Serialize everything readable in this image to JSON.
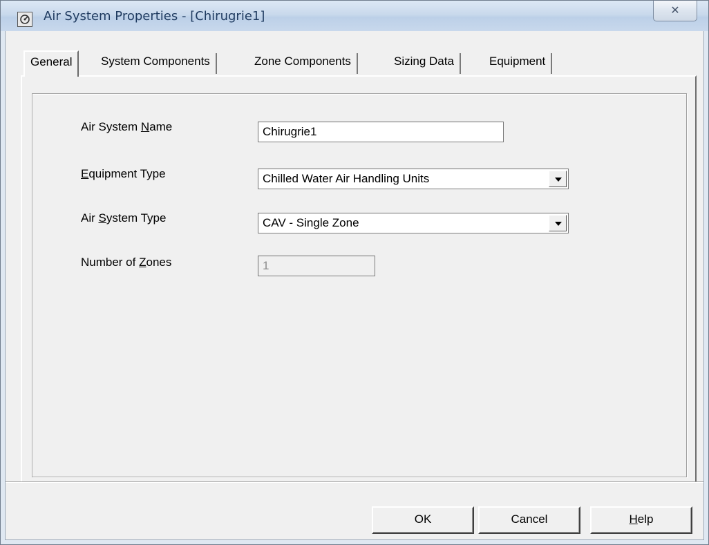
{
  "window": {
    "title": "Air System Properties - [Chirugrie1]",
    "close_glyph": "✕"
  },
  "tabs": [
    {
      "label": "General",
      "active": true
    },
    {
      "label": "System Components",
      "active": false
    },
    {
      "label": "Zone Components",
      "active": false
    },
    {
      "label": "Sizing Data",
      "active": false
    },
    {
      "label": "Equipment",
      "active": false
    }
  ],
  "form": {
    "name_label_pre": "Air System ",
    "name_label_u": "N",
    "name_label_post": "ame",
    "name_value": "Chirugrie1",
    "equip_label_u": "E",
    "equip_label_post": "quipment Type",
    "equip_value": "Chilled Water Air Handling Units",
    "systype_label_pre": "Air ",
    "systype_label_u": "S",
    "systype_label_post": "ystem Type",
    "systype_value": "CAV - Single Zone",
    "zones_label_pre": "Number of ",
    "zones_label_u": "Z",
    "zones_label_post": "ones",
    "zones_value": "1"
  },
  "buttons": {
    "ok": "OK",
    "cancel": "Cancel",
    "help_u": "H",
    "help_post": "elp"
  },
  "icons": {
    "app": "air-system-icon",
    "dropdown": "chevron-down-icon",
    "close": "close-icon"
  }
}
